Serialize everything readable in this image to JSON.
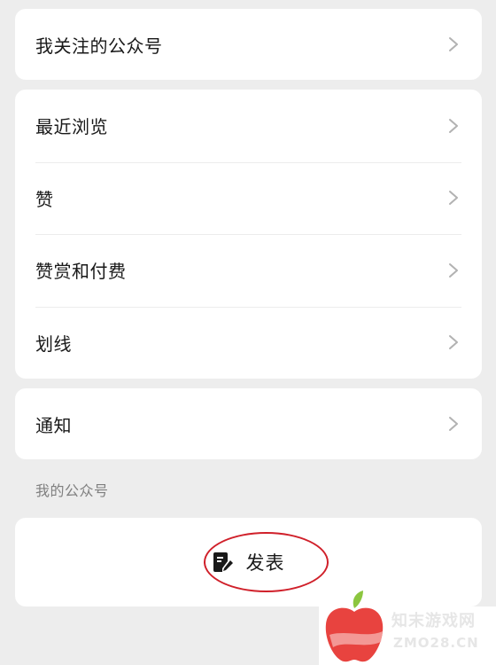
{
  "card_top": {
    "items": [
      {
        "label": "我关注的公众号"
      }
    ]
  },
  "card_middle": {
    "items": [
      {
        "label": "最近浏览"
      },
      {
        "label": "赞"
      },
      {
        "label": "赞赏和付费"
      },
      {
        "label": "划线"
      }
    ]
  },
  "card_notify": {
    "items": [
      {
        "label": "通知"
      }
    ]
  },
  "my_accounts": {
    "caption": "我的公众号",
    "publish_label": "发表",
    "publish_icon": "edit-document-icon"
  },
  "watermark": {
    "text_cn": "知末游戏网",
    "text_en": "ZMO28.CN"
  },
  "colors": {
    "highlight_ring": "#d0202a",
    "background": "#ededed",
    "card": "#ffffff"
  }
}
